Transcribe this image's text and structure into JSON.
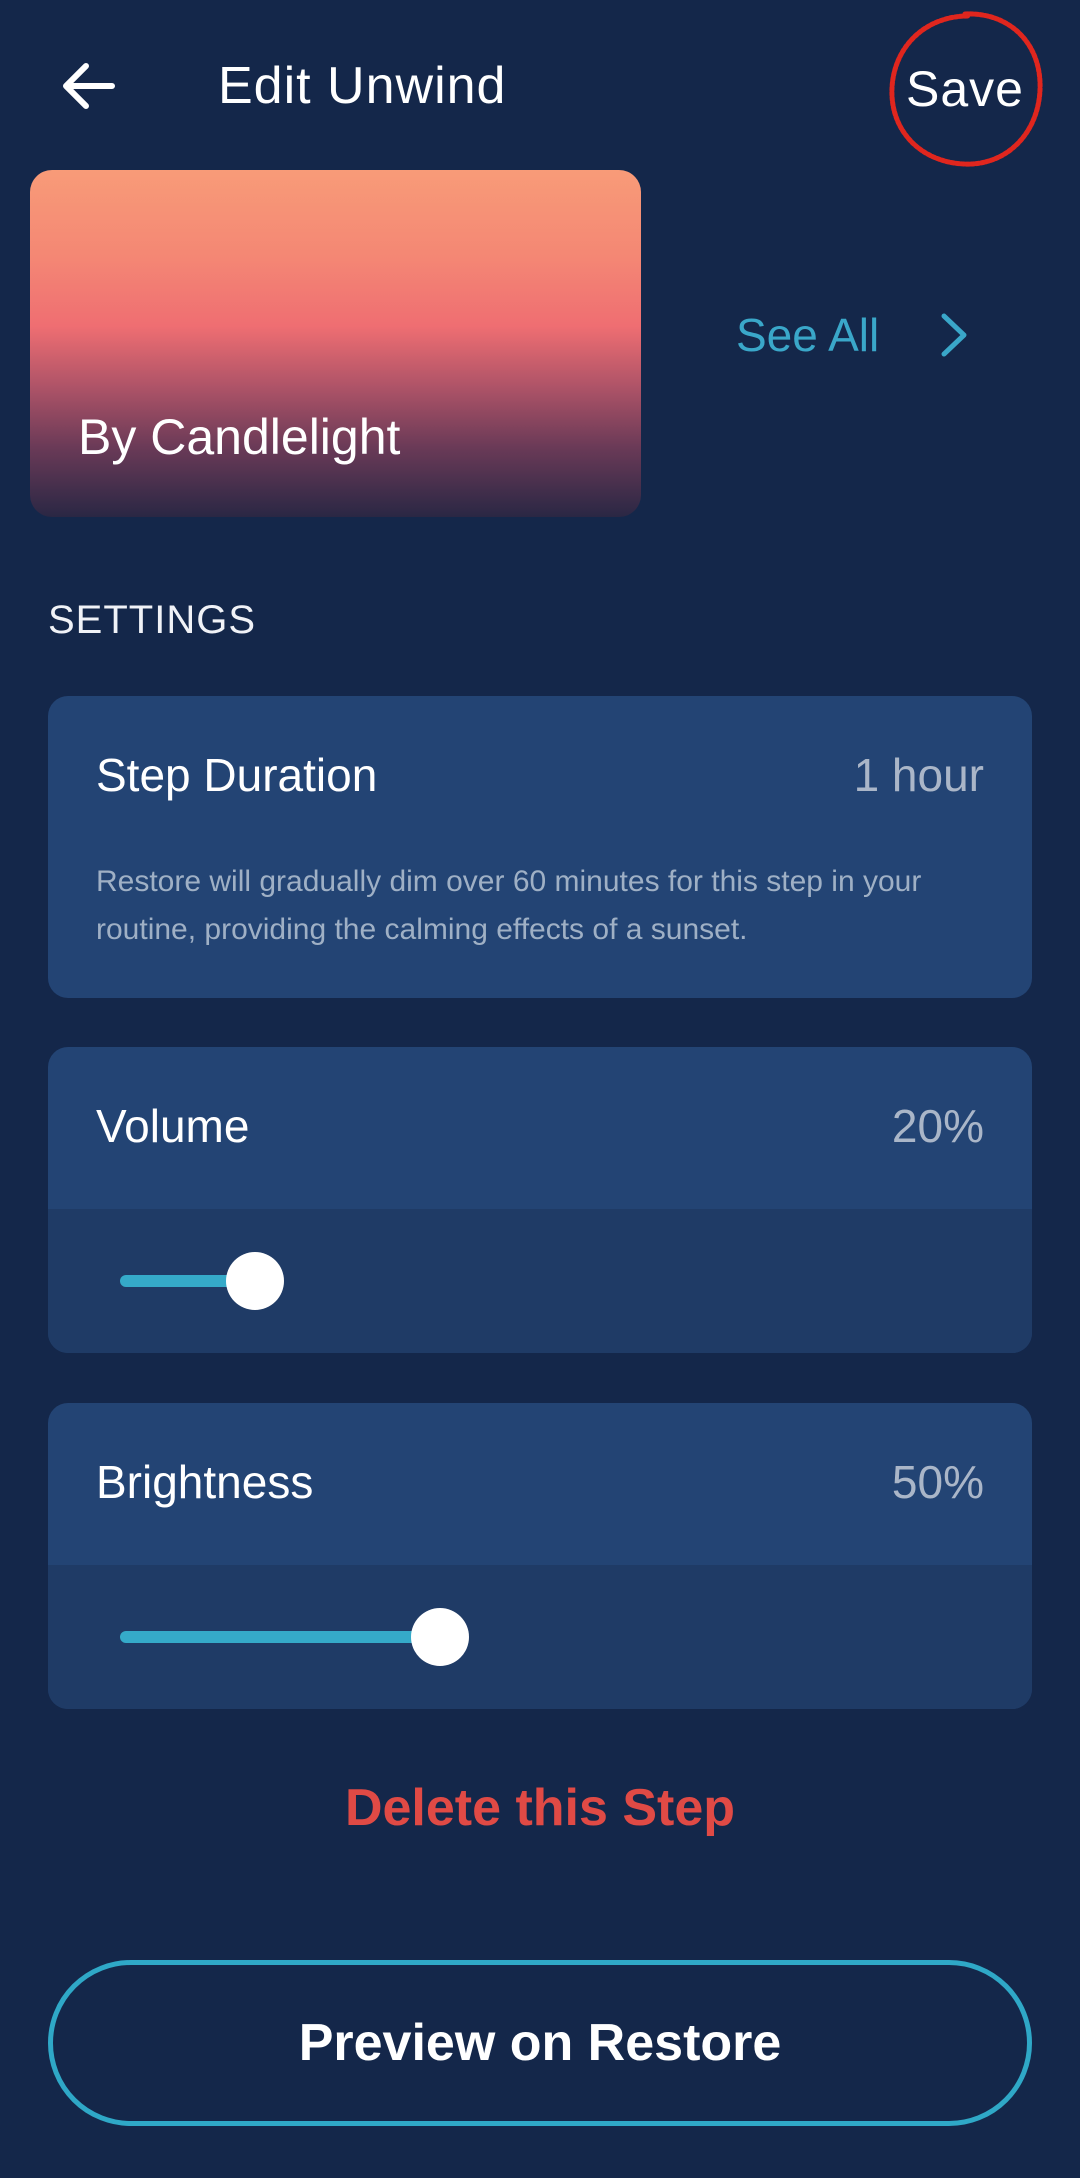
{
  "header": {
    "back_icon": "arrow-left-icon",
    "title": "Edit Unwind",
    "save_label": "Save",
    "save_highlight_color": "#e0261e"
  },
  "sound": {
    "name": "By Candlelight",
    "see_all_label": "See All",
    "see_all_icon": "chevron-right-icon"
  },
  "settings": {
    "section_label": "SETTINGS",
    "step_duration": {
      "title": "Step Duration",
      "value": "1 hour",
      "description": "Restore will gradually dim over 60 minutes for this step in your routine, providing the calming effects of a sunset."
    },
    "volume": {
      "title": "Volume",
      "value": "20%",
      "level": 0.2
    },
    "brightness": {
      "title": "Brightness",
      "value": "50%",
      "level": 0.5
    }
  },
  "actions": {
    "delete_label": "Delete this Step",
    "preview_label": "Preview on Restore"
  },
  "colors": {
    "background": "#14274a",
    "card": "#234474",
    "accent": "#35aac9",
    "danger": "#e04a45"
  }
}
